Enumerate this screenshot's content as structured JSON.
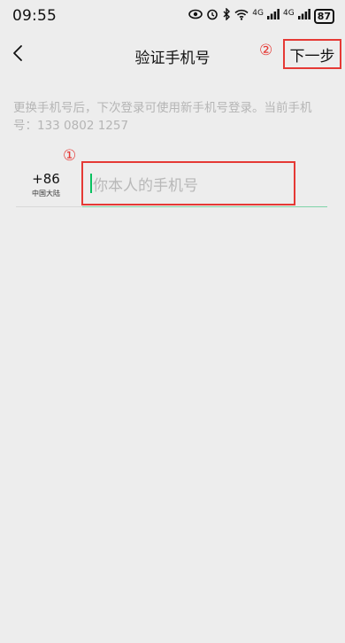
{
  "status_bar": {
    "time": "09:55",
    "network_label_1": "4G",
    "network_label_2": "4G",
    "battery": "87"
  },
  "nav": {
    "title": "验证手机号",
    "next_label": "下一步"
  },
  "annotations": {
    "marker_1": "①",
    "marker_2": "②",
    "highlight_color": "#e53935"
  },
  "description": "更换手机号后，下次登录可使用新手机号登录。当前手机号：133 0802 1257",
  "phone": {
    "region_code": "+86",
    "region_name": "中国大陆",
    "placeholder": "你本人的手机号",
    "value": ""
  },
  "colors": {
    "background": "#ededed",
    "caret": "#07c160",
    "hint_text": "#b5b5b5"
  }
}
